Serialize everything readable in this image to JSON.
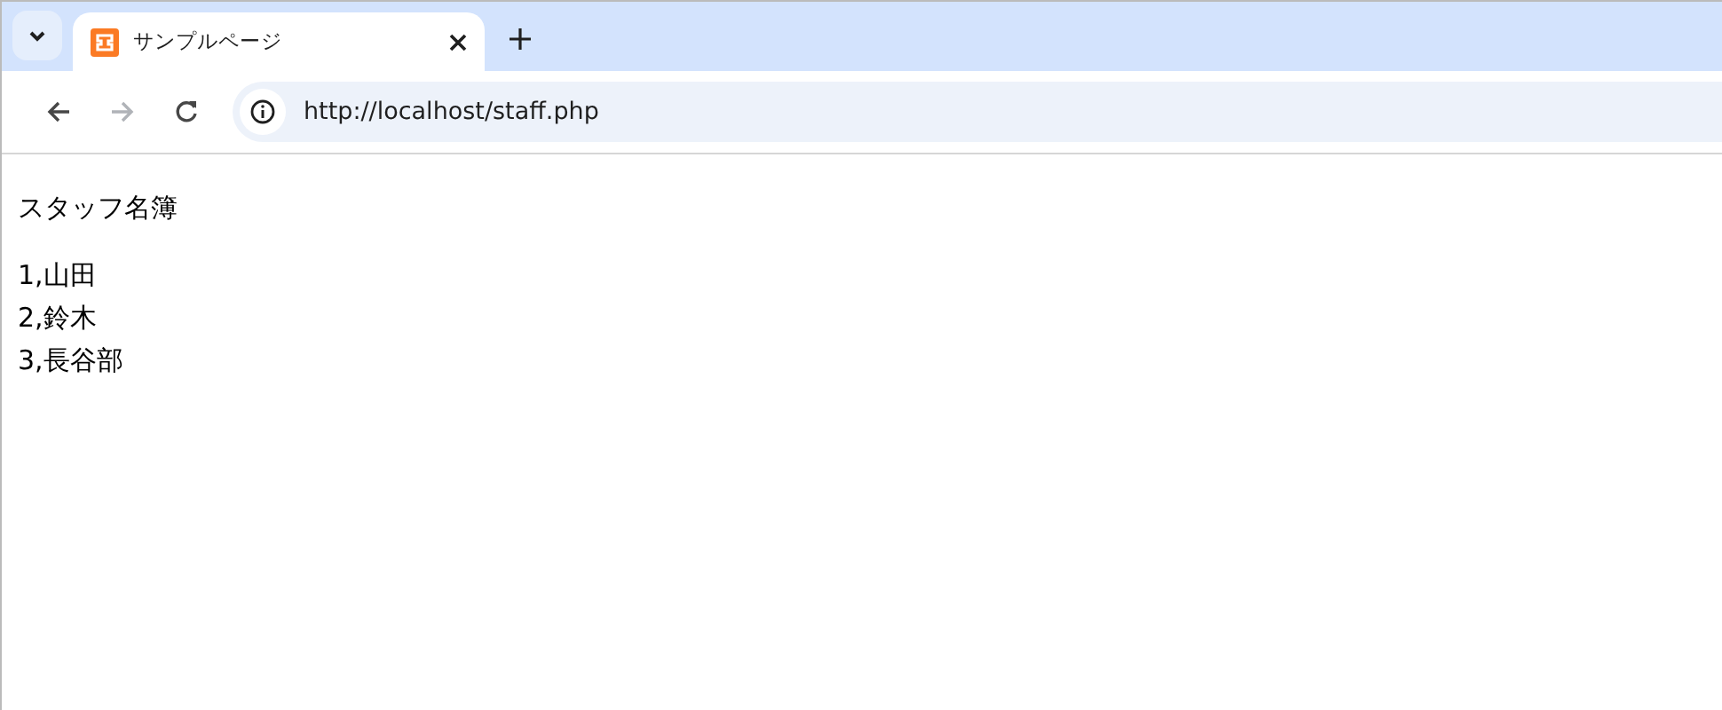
{
  "tabs": [
    {
      "title": "サンプルページ",
      "selected": true
    }
  ],
  "nav_buttons": [
    {
      "kind": "back",
      "disabled": false
    },
    {
      "kind": "forward",
      "disabled": true
    },
    {
      "kind": "reload",
      "disabled": false
    }
  ],
  "address_bar": {
    "url": "http://localhost/staff.php"
  },
  "page": {
    "heading": "スタッフ名簿",
    "lines": [
      "1,山田",
      "2,鈴木",
      "3,長谷部"
    ]
  }
}
